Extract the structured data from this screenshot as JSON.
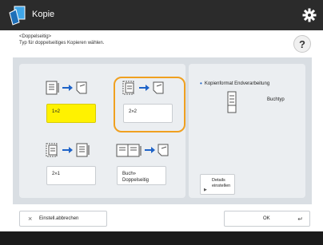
{
  "titlebar": {
    "title": "Kopie"
  },
  "header": {
    "heading": "<Doppelseitig>",
    "instruction": "Typ für doppelseitiges Kopieren wählen.",
    "help_label": "?"
  },
  "options": [
    {
      "label": "1»2",
      "state": "yellow"
    },
    {
      "label": "2»2",
      "state": "focused"
    },
    {
      "label": "2»1",
      "state": "normal"
    },
    {
      "label_line1": "Buch»",
      "label_line2": "Doppelseitig",
      "state": "normal"
    }
  ],
  "finish_panel": {
    "label": "Kopienformat Endverarbeitung",
    "value": "Buchtyp",
    "details_line1": "Details",
    "details_line2": "einstellen"
  },
  "footer": {
    "cancel_label": "Einstell.abbrechen",
    "ok_label": "OK"
  },
  "colors": {
    "selected": "#fff200",
    "focus_ring": "#f0a020",
    "titlebar": "#2b2b2b",
    "panel": "#d9dee3"
  }
}
